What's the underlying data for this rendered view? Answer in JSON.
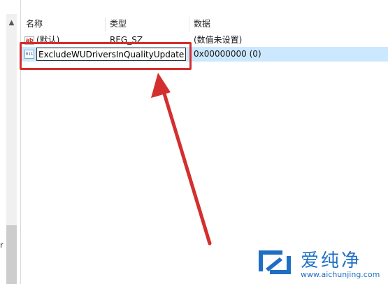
{
  "tree": {
    "partial_text": "r",
    "scroll_up_glyph": "▲"
  },
  "list": {
    "headers": {
      "name": "名称",
      "type": "类型",
      "data": "数据"
    },
    "rows": [
      {
        "icon": "string-value-icon",
        "icon_glyph": "ab",
        "name": "(默认)",
        "type": "REG_SZ",
        "data": "(数值未设置)"
      },
      {
        "icon": "binary-value-icon",
        "icon_glyph": "011",
        "name": "ExcludeWUDriversInQualityUpdate",
        "type": "",
        "data": "0x00000000 (0)"
      }
    ]
  },
  "rename": {
    "value": "ExcludeWUDriversInQualityUpdate"
  },
  "annotation": {
    "color": "#d32f2f"
  },
  "watermark": {
    "text": "爱纯净",
    "url": "www.aichunjing.com",
    "color": "#1e6fc4"
  },
  "colors": {
    "selection": "#cce8ff"
  }
}
